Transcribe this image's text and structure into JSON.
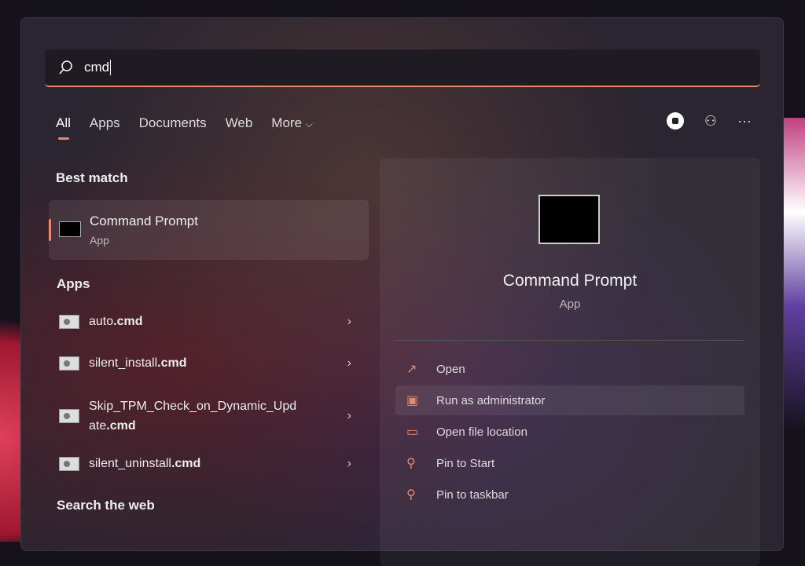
{
  "search": {
    "query": "cmd"
  },
  "tabs": [
    "All",
    "Apps",
    "Documents",
    "Web",
    "More"
  ],
  "best_match": {
    "heading": "Best match",
    "name": "Command Prompt",
    "type": "App"
  },
  "apps": {
    "heading": "Apps",
    "items": [
      {
        "name": "auto",
        "ext": ".cmd"
      },
      {
        "name": "silent_install",
        "ext": ".cmd"
      },
      {
        "name": "Skip_TPM_Check_on_Dynamic_Upd",
        "name2": "ate",
        "ext": ".cmd"
      },
      {
        "name": "silent_uninstall",
        "ext": ".cmd"
      }
    ]
  },
  "search_web": {
    "heading": "Search the web"
  },
  "detail": {
    "name": "Command Prompt",
    "type": "App",
    "actions": [
      "Open",
      "Run as administrator",
      "Open file location",
      "Pin to Start",
      "Pin to taskbar"
    ]
  },
  "colors": {
    "accent": "#e5896f"
  }
}
